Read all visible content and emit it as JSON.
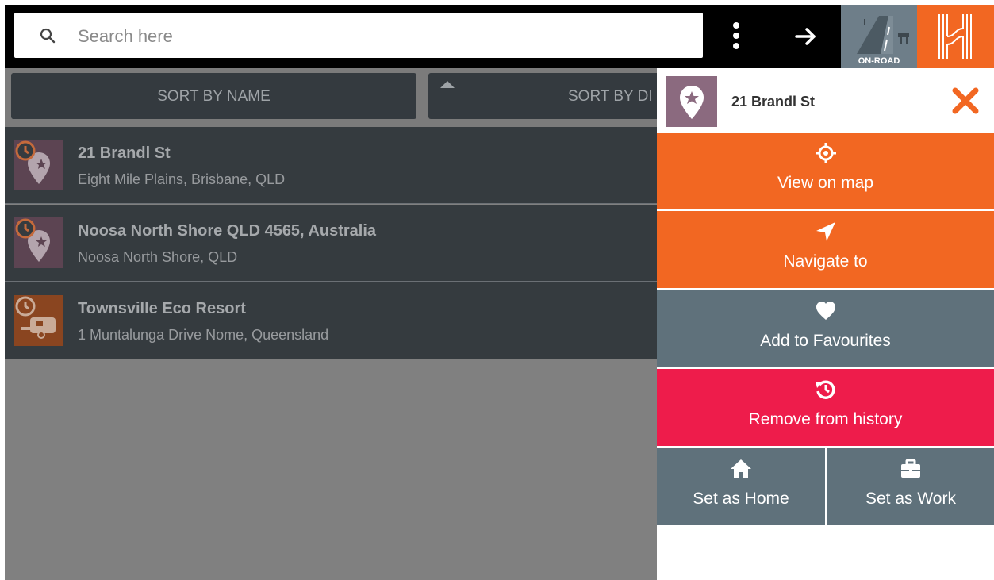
{
  "search": {
    "placeholder": "Search here",
    "icon": "search-icon"
  },
  "topbar": {
    "menu_icon": "more-vert-icon",
    "arrow_icon": "arrow-right-icon",
    "onroad_label": "ON-ROAD",
    "brand_icon": "hema-logo-icon"
  },
  "sort": {
    "by_name": "SORT BY NAME",
    "by_distance": "SORT BY DI"
  },
  "list": {
    "items": [
      {
        "title": "21 Brandl St",
        "subtitle": "Eight Mile Plains, Brisbane, QLD",
        "icon": "history-favourite-pin-icon"
      },
      {
        "title": "Noosa North Shore QLD 4565, Australia",
        "subtitle": "Noosa North Shore, QLD",
        "icon": "history-favourite-pin-icon"
      },
      {
        "title": "Townsville Eco Resort",
        "subtitle": "1 Muntalunga Drive Nome, Queensland",
        "icon": "history-caravan-icon"
      }
    ]
  },
  "panel": {
    "title": "21 Brandl St",
    "actions": {
      "view_on_map": "View on map",
      "navigate_to": "Navigate to",
      "add_favourites": "Add to Favourites",
      "remove_history": "Remove from history",
      "set_home": "Set as Home",
      "set_work": "Set as Work"
    }
  },
  "colors": {
    "accent_orange": "#f26722",
    "slate": "#5f717b",
    "danger": "#ee1c4b",
    "list_bg": "#353b3f"
  }
}
